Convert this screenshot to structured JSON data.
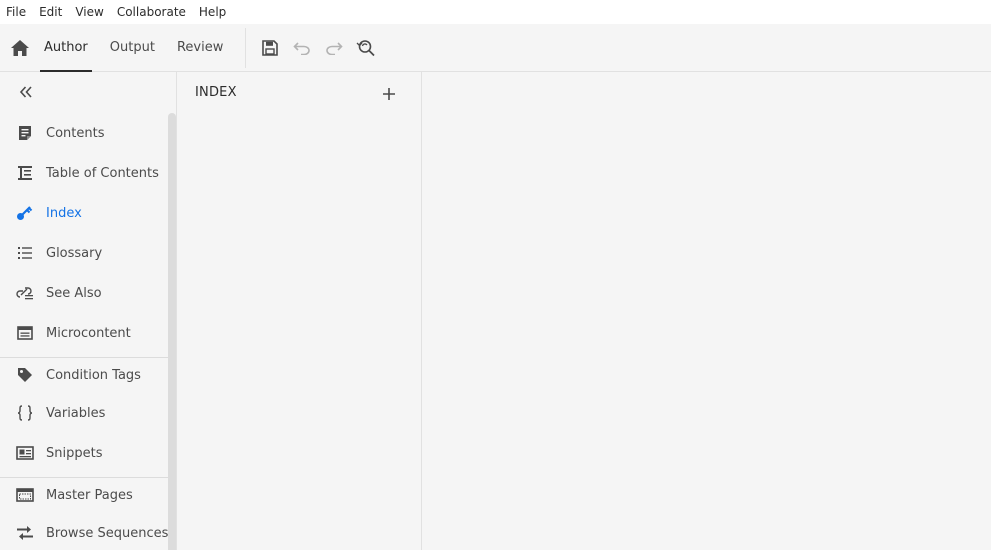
{
  "menubar": {
    "items": [
      "File",
      "Edit",
      "View",
      "Collaborate",
      "Help"
    ]
  },
  "toolbar": {
    "tabs": [
      {
        "label": "Author",
        "active": true
      },
      {
        "label": "Output",
        "active": false
      },
      {
        "label": "Review",
        "active": false
      }
    ],
    "icons": [
      "home-icon",
      "save-icon",
      "undo-icon",
      "redo-icon",
      "find-replace-icon"
    ]
  },
  "sidebar": {
    "items": [
      {
        "label": "Contents",
        "icon": "contents-icon",
        "active": false
      },
      {
        "label": "Table of Contents",
        "icon": "toc-icon",
        "active": false
      },
      {
        "label": "Index",
        "icon": "key-icon",
        "active": true
      },
      {
        "label": "Glossary",
        "icon": "glossary-icon",
        "active": false
      },
      {
        "label": "See Also",
        "icon": "see-also-icon",
        "active": false
      },
      {
        "label": "Microcontent",
        "icon": "microcontent-icon",
        "active": false
      },
      {
        "label": "Condition Tags",
        "icon": "tag-icon",
        "active": false
      },
      {
        "label": "Variables",
        "icon": "braces-icon",
        "active": false
      },
      {
        "label": "Snippets",
        "icon": "snippet-icon",
        "active": false
      },
      {
        "label": "Master Pages",
        "icon": "master-page-icon",
        "active": false
      },
      {
        "label": "Browse Sequences",
        "icon": "browse-sequence-icon",
        "active": false
      }
    ]
  },
  "index_panel": {
    "title": "INDEX"
  },
  "colors": {
    "accent": "#1473e6",
    "text": "#2c2c2c",
    "icon": "#4b4b4b",
    "background": "#f5f5f5"
  }
}
